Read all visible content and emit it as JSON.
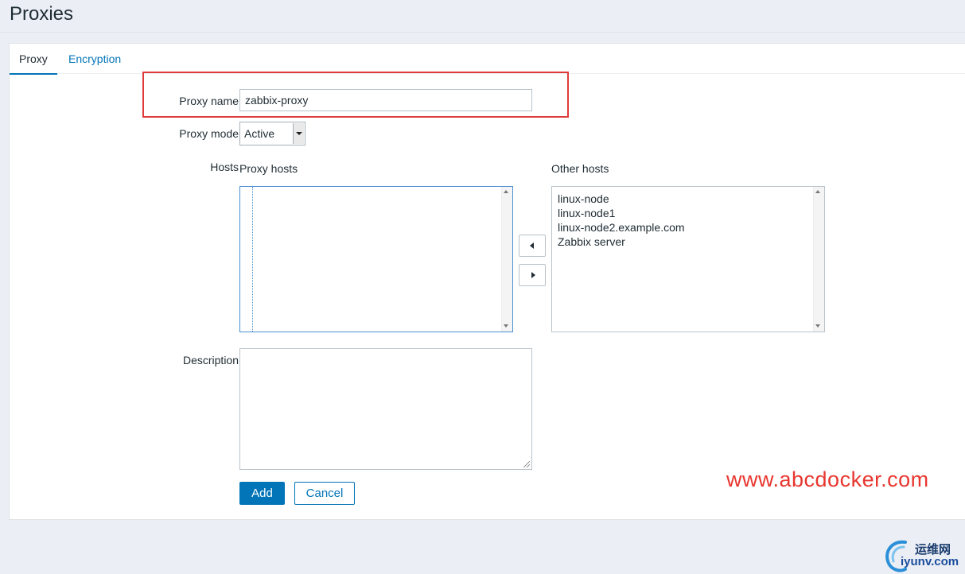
{
  "page": {
    "title": "Proxies"
  },
  "tabs": [
    {
      "label": "Proxy",
      "active": true
    },
    {
      "label": "Encryption",
      "active": false
    }
  ],
  "form": {
    "proxy_name_label": "Proxy name",
    "proxy_name_value": "zabbix-proxy",
    "proxy_mode_label": "Proxy mode",
    "proxy_mode_value": "Active",
    "hosts_label": "Hosts",
    "proxy_hosts_heading": "Proxy hosts",
    "other_hosts_heading": "Other hosts",
    "proxy_hosts": [],
    "other_hosts": [
      "linux-node",
      "linux-node1",
      "linux-node2.example.com",
      "Zabbix server"
    ],
    "description_label": "Description",
    "description_value": "",
    "add_label": "Add",
    "cancel_label": "Cancel"
  },
  "watermark": {
    "site": "www.abcdocker.com",
    "logo_cn": "运维网",
    "logo_en": "iyunv.com"
  },
  "colors": {
    "accent": "#0275b8",
    "highlight_box": "#e0393a",
    "watermark": "#e8362f"
  }
}
